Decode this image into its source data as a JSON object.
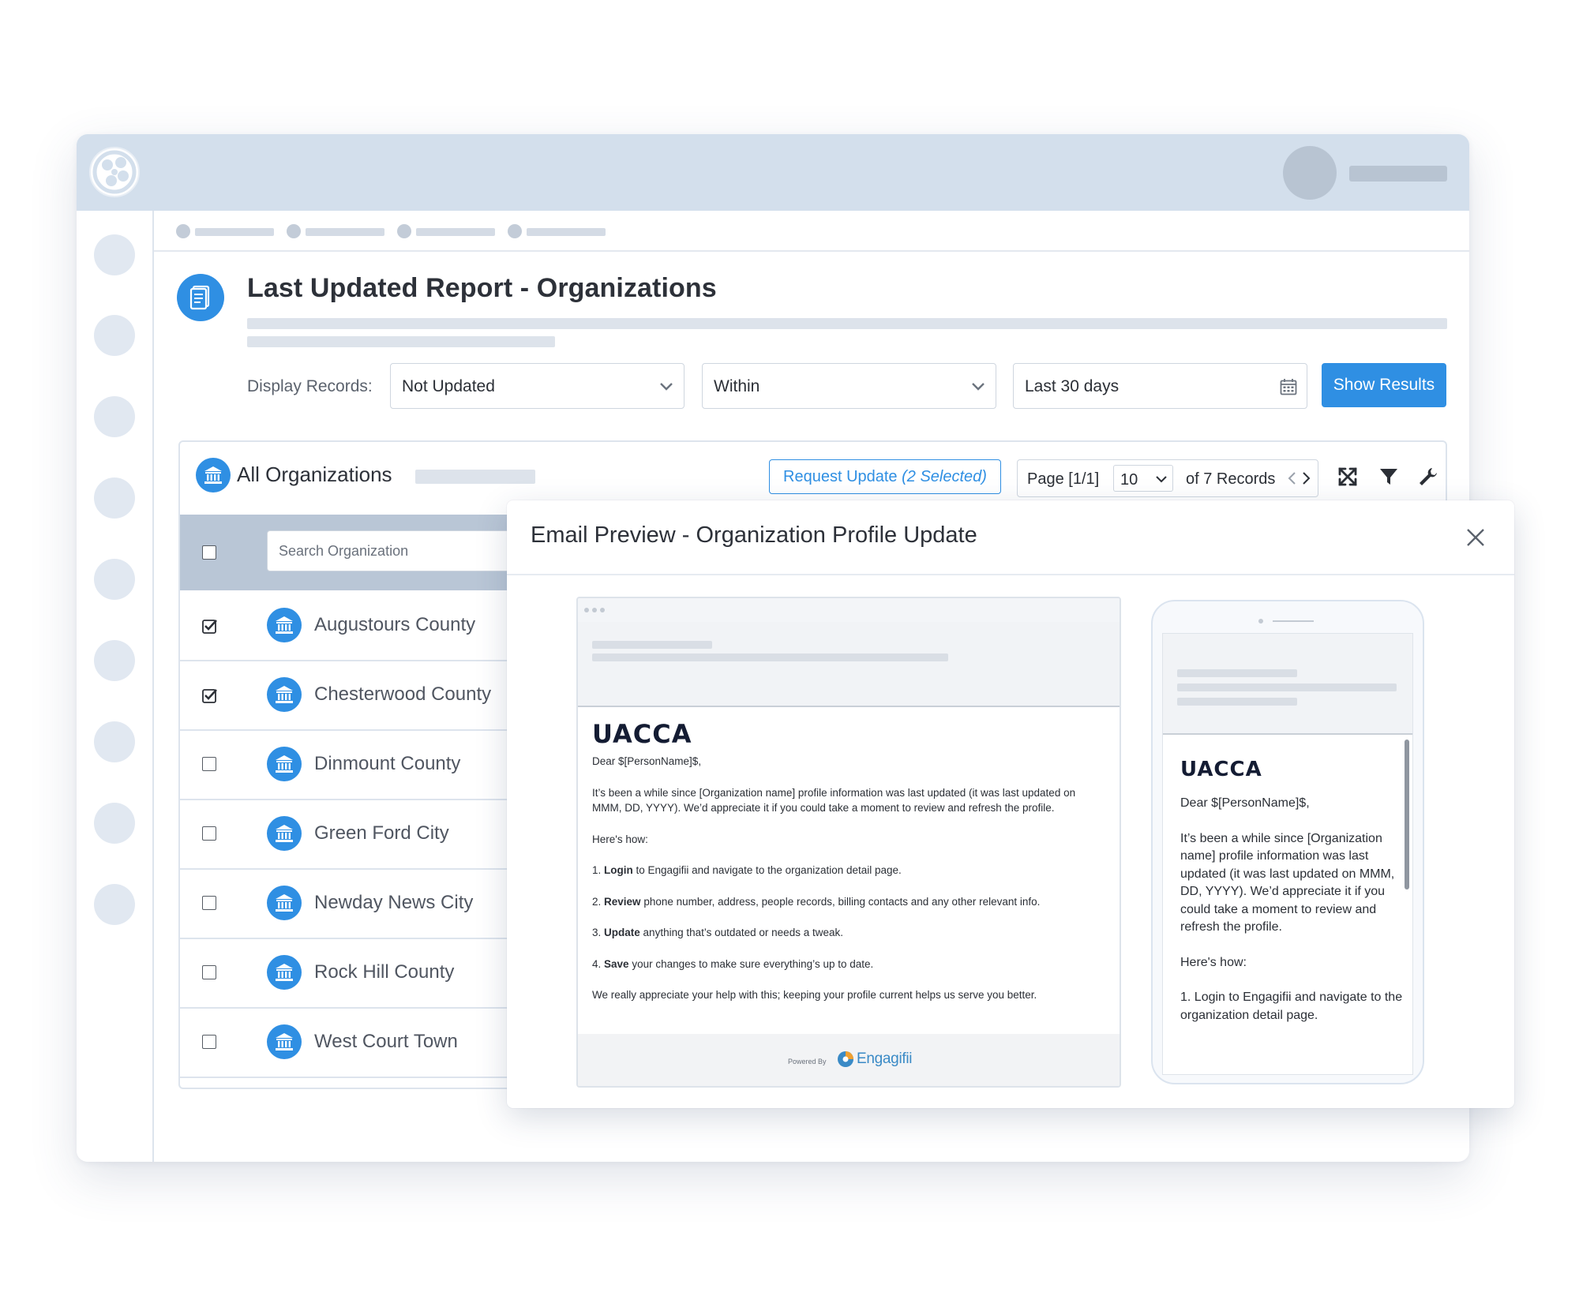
{
  "report": {
    "title": "Last Updated Report - Organizations"
  },
  "filters": {
    "label": "Display Records:",
    "status_value": "Not Updated",
    "range_value": "Within",
    "date_value": "Last 30 days",
    "submit_label": "Show Results"
  },
  "panel": {
    "title": "All Organizations",
    "request_label": "Request Update",
    "request_selected": "(2 Selected)",
    "page_label": "Page [1/1]",
    "page_size": "10",
    "records_label": "of 7 Records"
  },
  "table": {
    "search_placeholder": "Search Organization",
    "rows": [
      {
        "name": "Augustours County",
        "checked": true
      },
      {
        "name": "Chesterwood County",
        "checked": true
      },
      {
        "name": "Dinmount County",
        "checked": false
      },
      {
        "name": "Green Ford City",
        "checked": false
      },
      {
        "name": "Newday News City",
        "checked": false
      },
      {
        "name": "Rock Hill County",
        "checked": false
      },
      {
        "name": "West Court Town",
        "checked": false
      }
    ]
  },
  "modal": {
    "title": "Email Preview - Organization Profile Update"
  },
  "email": {
    "brand": "UACCA",
    "greeting": "Dear $[PersonName]$,",
    "intro": "It’s been a while since [Organization name] profile information was last updated (it was last updated on MMM, DD, YYYY). We’d appreciate it if you could take a moment to review and refresh the profile.",
    "howto": "Here's how:",
    "steps": [
      {
        "num": "1.",
        "bold": "Login",
        "text": " to Engagifii and navigate to the organization detail page."
      },
      {
        "num": "2.",
        "bold": "Review",
        "text": " phone number, address, people records, billing contacts and any other relevant info."
      },
      {
        "num": "3.",
        "bold": "Update",
        "text": " anything that’s outdated or needs a tweak."
      },
      {
        "num": "4.",
        "bold": "Save",
        "text": " your changes to make sure everything’s up to date."
      }
    ],
    "closing": "We really appreciate your help with this; keeping your profile current helps us serve you better.",
    "powered_by": "Powered By",
    "footer_logo": "Engagifii",
    "mobile_step1": "1. Login to Engagifii and navigate to the organization detail page."
  },
  "colors": {
    "accent": "#2f8fe3",
    "topbar": "#d3dfec",
    "table_header": "#b9c6d6"
  },
  "icons": {
    "logo": "app-logo-icon",
    "report": "document-icon",
    "organization": "bank-building-icon",
    "calendar": "calendar-icon",
    "expand": "expand-icon",
    "filter": "filter-icon",
    "settings": "wrench-icon",
    "close": "close-icon"
  }
}
